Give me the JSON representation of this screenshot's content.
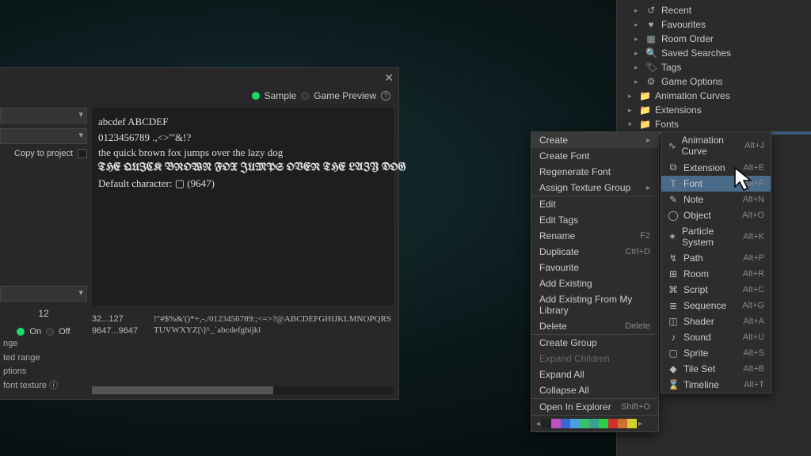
{
  "font_panel": {
    "tabs": {
      "sample": "Sample",
      "game_preview": "Game Preview"
    },
    "copy_to_project": "Copy to project",
    "size": "12",
    "on": "On",
    "off": "Off",
    "preview_lines": [
      "abcdef ABCDEF",
      "0123456789 .,<>\"'&!?",
      "the quick brown fox jumps over the lazy dog",
      "THE QUICK BROWN FOX JUMPS OVER THE LAZY DOG",
      "Default character: ▢ (9647)"
    ],
    "range_labels": [
      "nge",
      "ted range",
      "ptions",
      "font texture   ⓘ"
    ],
    "charset_ranges": [
      "32...127",
      "9647...9647"
    ],
    "charset_glyphs": "!\"#$%&'()*+,-./0123456789:;<=>?@ABCDEFGHIJKLMNOPQRSTUVWXYZ[\\]^_`abcdefghijkl"
  },
  "tree": {
    "quick": [
      {
        "icon": "↺",
        "label": "Recent"
      },
      {
        "icon": "♥",
        "label": "Favourites"
      },
      {
        "icon": "▦",
        "label": "Room Order"
      },
      {
        "icon": "🔍",
        "label": "Saved Searches"
      },
      {
        "icon": "🏷",
        "label": "Tags"
      },
      {
        "icon": "⚙",
        "label": "Game Options"
      }
    ],
    "folders": [
      {
        "label": "Animation Curves",
        "open": false
      },
      {
        "label": "Extensions",
        "open": false
      },
      {
        "label": "Fonts",
        "open": true
      }
    ]
  },
  "context_menu": {
    "create": "Create",
    "items": [
      {
        "label": "Create Font"
      },
      {
        "label": "Regenerate Font"
      },
      {
        "label": "Assign Texture Group",
        "submenu": true
      },
      {
        "sep": true,
        "label": "Edit"
      },
      {
        "label": "Edit Tags"
      },
      {
        "label": "Rename",
        "kbd": "F2"
      },
      {
        "label": "Duplicate",
        "kbd": "Ctrl+D"
      },
      {
        "label": "Favourite"
      },
      {
        "label": "Add Existing"
      },
      {
        "label": "Add Existing From My Library"
      },
      {
        "label": "Delete",
        "kbd": "Delete"
      },
      {
        "sep": true,
        "label": "Create Group"
      },
      {
        "label": "Expand Children",
        "disabled": true
      },
      {
        "label": "Expand All"
      },
      {
        "label": "Collapse All"
      },
      {
        "sep": true,
        "label": "Open In Explorer",
        "kbd": "Shift+O"
      }
    ],
    "colors": [
      "#222222",
      "#c050c0",
      "#3a6ad0",
      "#4aa0e0",
      "#38c070",
      "#3aa090",
      "#2bd048",
      "#d03030",
      "#d07030",
      "#d0d030"
    ]
  },
  "submenu": {
    "items": [
      {
        "icon": "∿",
        "label": "Animation Curve",
        "kbd": "Alt+J"
      },
      {
        "icon": "⧉",
        "label": "Extension",
        "kbd": "Alt+E"
      },
      {
        "icon": "T",
        "label": "Font",
        "kbd": "Alt+F",
        "selected": true
      },
      {
        "icon": "✎",
        "label": "Note",
        "kbd": "Alt+N"
      },
      {
        "icon": "◯",
        "label": "Object",
        "kbd": "Alt+O"
      },
      {
        "icon": "✶",
        "label": "Particle System",
        "kbd": "Alt+K"
      },
      {
        "icon": "↯",
        "label": "Path",
        "kbd": "Alt+P"
      },
      {
        "icon": "⊞",
        "label": "Room",
        "kbd": "Alt+R"
      },
      {
        "icon": "⌘",
        "label": "Script",
        "kbd": "Alt+C"
      },
      {
        "icon": "≣",
        "label": "Sequence",
        "kbd": "Alt+G"
      },
      {
        "icon": "◫",
        "label": "Shader",
        "kbd": "Alt+A"
      },
      {
        "icon": "♪",
        "label": "Sound",
        "kbd": "Alt+U"
      },
      {
        "icon": "▢",
        "label": "Sprite",
        "kbd": "Alt+S"
      },
      {
        "icon": "◆",
        "label": "Tile Set",
        "kbd": "Alt+B"
      },
      {
        "icon": "⌛",
        "label": "Timeline",
        "kbd": "Alt+T"
      }
    ]
  }
}
